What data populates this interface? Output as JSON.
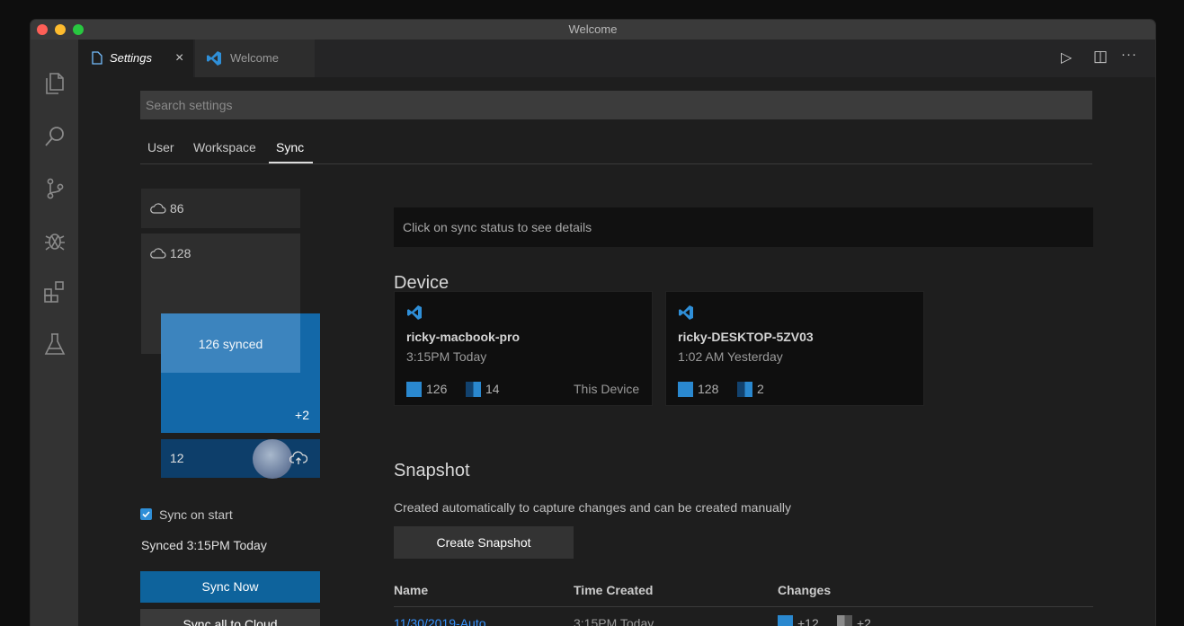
{
  "window": {
    "title": "Welcome"
  },
  "tabs": [
    {
      "label": "Settings",
      "close": "×"
    },
    {
      "label": "Welcome"
    }
  ],
  "editor_actions": {
    "run": "▷",
    "split": "◫",
    "more": "···"
  },
  "search": {
    "placeholder": "Search settings"
  },
  "settings_tabs": [
    "User",
    "Workspace",
    "Sync"
  ],
  "sync_panel": {
    "cloud_count_1": "86",
    "cloud_count_2": "128",
    "synced_label": "126 synced",
    "extra": "+2",
    "pending": "12",
    "sync_on_start_label": "Sync on start",
    "sync_on_start_checked": true,
    "synced_status": "Synced 3:15PM Today",
    "sync_now_button": "Sync Now",
    "sync_all_button": "Sync all to Cloud"
  },
  "details_hint": "Click on sync status to see details",
  "device": {
    "heading": "Device",
    "devices": [
      {
        "name": "ricky-macbook-pro",
        "time": "3:15PM Today",
        "count_a": "126",
        "count_b": "14",
        "tag": "This Device"
      },
      {
        "name": "ricky-DESKTOP-5ZV03",
        "time": "1:02 AM Yesterday",
        "count_a": "128",
        "count_b": "2",
        "tag": ""
      }
    ]
  },
  "snapshot": {
    "heading": "Snapshot",
    "description": "Created automatically to capture changes and can be created manually",
    "create_button": "Create Snapshot",
    "columns": [
      "Name",
      "Time Created",
      "Changes"
    ],
    "rows": [
      {
        "name": "11/30/2019-Auto",
        "time": "3:15PM Today",
        "changes_a": "+12",
        "changes_b": "+2"
      }
    ]
  },
  "colors": {
    "accent": "#0e639c",
    "vscode_blue": "#2f8fd8",
    "link": "#3794ff"
  }
}
